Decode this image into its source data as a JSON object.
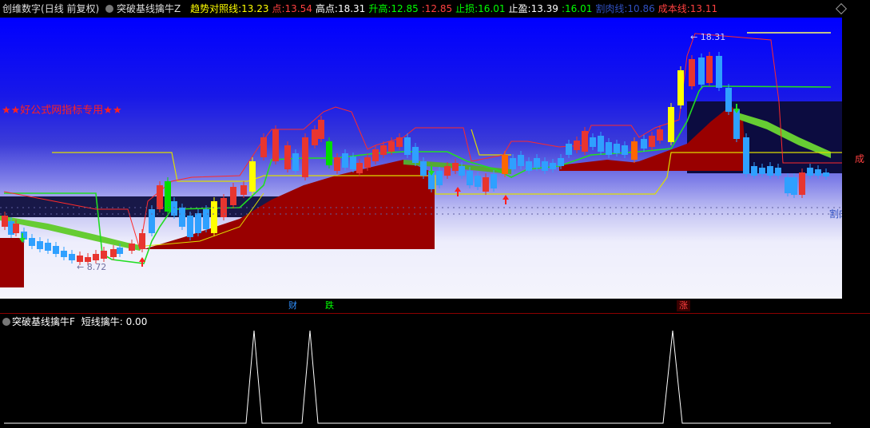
{
  "header": {
    "stock_name": "创维数字",
    "period": "(日线 前复权)",
    "indicator_name": "突破基线擒牛Z",
    "items": [
      {
        "label": "趋势对照线:",
        "value": "13.23",
        "color": "#ffff00"
      },
      {
        "label": "点:",
        "value": "13.54",
        "color": "#ff4040"
      },
      {
        "label": "高点:",
        "value": "18.31",
        "color": "#ffffff"
      },
      {
        "label": "升高:",
        "value": "12.85",
        "color": "#00ff00"
      },
      {
        "label": ":",
        "value": "12.85",
        "color": "#ff4040"
      },
      {
        "label": "止损:",
        "value": "16.01",
        "color": "#00ff00"
      },
      {
        "label": "止盈:",
        "value": "13.39",
        "color": "#ffffff"
      },
      {
        "label": ":",
        "value": "16.01",
        "color": "#00ff00"
      },
      {
        "label": "割肉线:",
        "value": "10.86",
        "color": "#3050c0"
      },
      {
        "label": "成本线:",
        "value": "13.11",
        "color": "#ff4040"
      }
    ]
  },
  "chart": {
    "watermark": "★★好公式网指标专用★★",
    "high_label": "18.31",
    "low_label": "8.72",
    "cut_loss_label": "割肉线",
    "cost_label": "成"
  },
  "signals": [
    {
      "text": "财",
      "color": "#3090ff"
    },
    {
      "text": "跌",
      "color": "#00ff00"
    },
    {
      "text": "涨",
      "color": "#ff4040"
    }
  ],
  "subchart": {
    "indicator_name": "突破基线擒牛F",
    "series_label": "短线擒牛:",
    "series_value": "0.00"
  },
  "colors": {
    "up": "#e8352f",
    "down": "#2fa0ff",
    "trend": "#ffff00",
    "support": "#00ff00",
    "stop": "#ff3030"
  }
}
